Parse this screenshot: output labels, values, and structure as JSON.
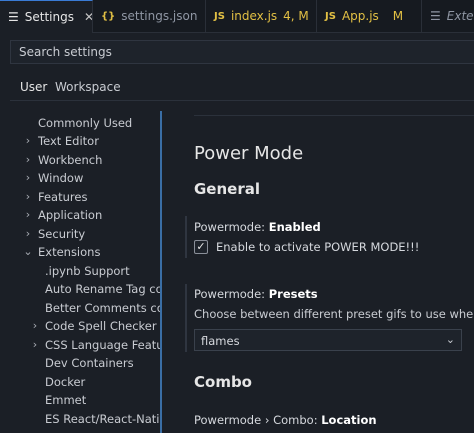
{
  "tabs": [
    {
      "label": "Settings",
      "icon": "hamburger-icon",
      "active": true,
      "close": "✕"
    },
    {
      "label": "settings.json",
      "icon_text": "{}",
      "icon": "json-braces-icon",
      "icon_color": "#e2c044"
    },
    {
      "label": "index.js",
      "icon_text": "JS",
      "icon": "javascript-icon",
      "icon_color": "#e2c044",
      "badge": "4, M",
      "badge_color": "#e2c044"
    },
    {
      "label": "App.js",
      "icon_text": "JS",
      "icon": "javascript-icon",
      "icon_color": "#e2c044",
      "badge": "M",
      "badge_color": "#e2c044"
    },
    {
      "label": "Extens",
      "icon": "list-icon"
    }
  ],
  "search": {
    "placeholder": "Search settings"
  },
  "scopes": [
    "User",
    "Workspace"
  ],
  "toc": [
    {
      "label": "Commonly Used",
      "level": 0,
      "chevron": false
    },
    {
      "label": "Text Editor",
      "level": 0,
      "chevron": true
    },
    {
      "label": "Workbench",
      "level": 0,
      "chevron": true
    },
    {
      "label": "Window",
      "level": 0,
      "chevron": true
    },
    {
      "label": "Features",
      "level": 0,
      "chevron": true
    },
    {
      "label": "Application",
      "level": 0,
      "chevron": true
    },
    {
      "label": "Security",
      "level": 0,
      "chevron": true
    },
    {
      "label": "Extensions",
      "level": 0,
      "chevron": true,
      "expanded": true
    },
    {
      "label": ".ipynb Support",
      "level": 1,
      "chevron": false
    },
    {
      "label": "Auto Rename Tag con...",
      "level": 1,
      "chevron": false
    },
    {
      "label": "Better Comments con...",
      "level": 1,
      "chevron": false
    },
    {
      "label": "Code Spell Checker",
      "level": 1,
      "chevron": true
    },
    {
      "label": "CSS Language Features",
      "level": 1,
      "chevron": true
    },
    {
      "label": "Dev Containers",
      "level": 1,
      "chevron": false
    },
    {
      "label": "Docker",
      "level": 1,
      "chevron": false
    },
    {
      "label": "Emmet",
      "level": 1,
      "chevron": false
    },
    {
      "label": "ES React/React-Native...",
      "level": 1,
      "chevron": false
    }
  ],
  "content": {
    "title": "Power Mode",
    "section_general": "General",
    "enabled": {
      "prefix": "Powermode: ",
      "name": "Enabled",
      "checkbox_label": "Enable to activate POWER MODE!!!",
      "checked": true
    },
    "presets": {
      "prefix": "Powermode: ",
      "name": "Presets",
      "description": "Choose between different preset gifs to use when powerm",
      "value": "flames"
    },
    "section_combo": "Combo",
    "combo_location": {
      "prefix": "Powermode › Combo: ",
      "name": "Location"
    }
  }
}
